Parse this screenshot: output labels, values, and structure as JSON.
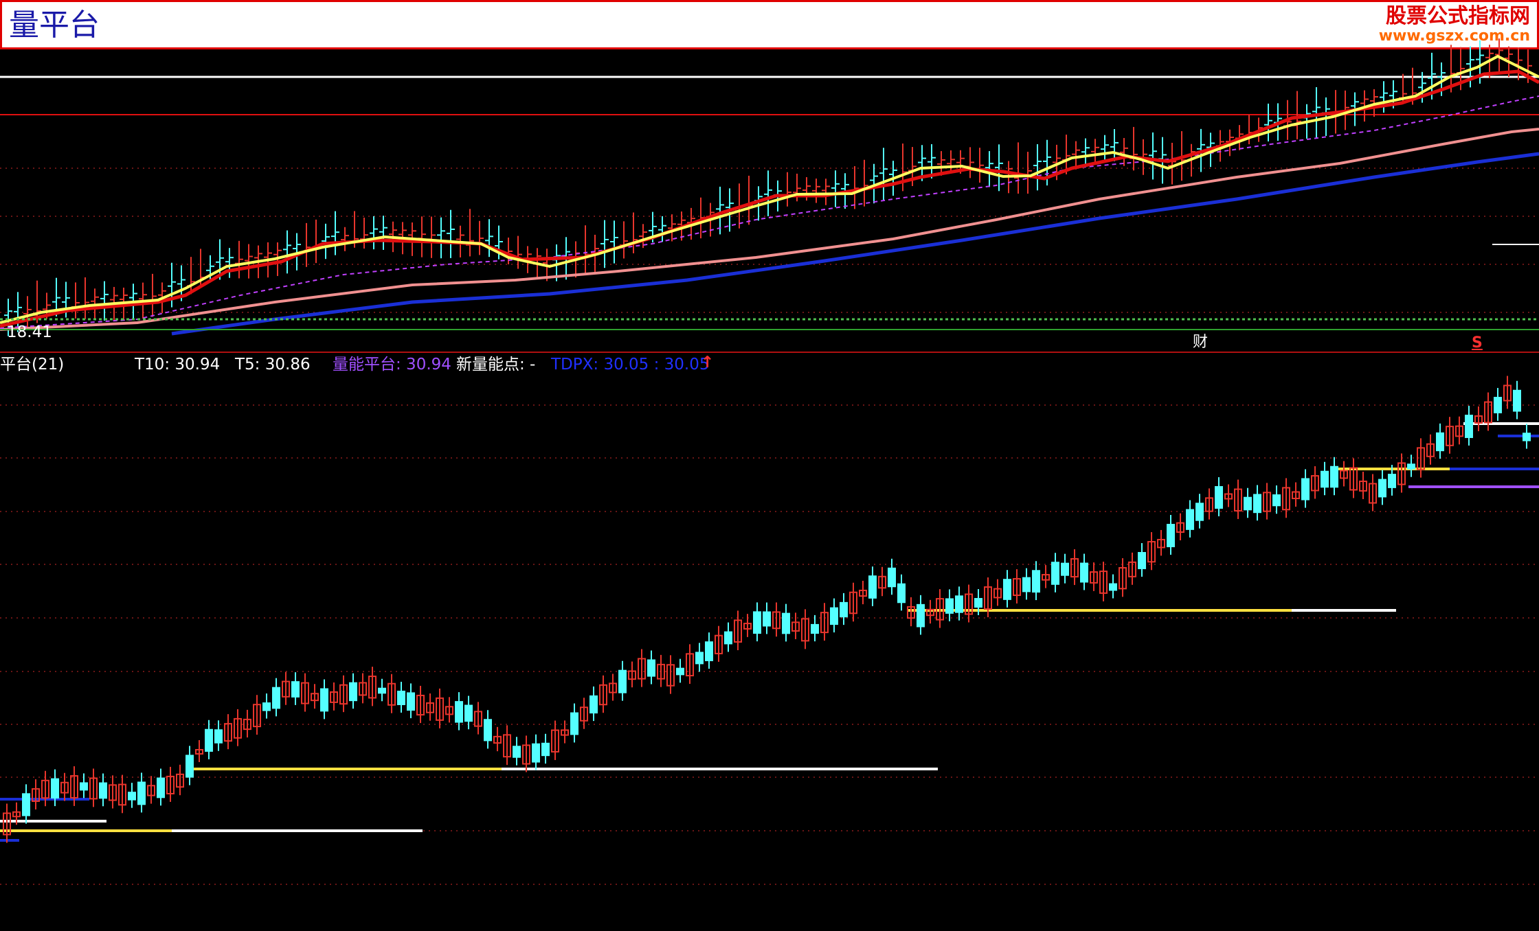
{
  "window": {
    "title": "量平台",
    "brand_cn": "股票公式指标网",
    "brand_url": "www.gszx.com.cn"
  },
  "main_panel": {
    "price_tag": "18.41",
    "finance_marker": "财",
    "signal_marker": "S"
  },
  "indicator_panel": {
    "name": "平台(21)",
    "t10": "T10: 30.94",
    "t5": "T5: 30.86",
    "volume_platform": "量能平台: 30.94",
    "new_volume_point": "新量能点: -",
    "tdpx": "TDPX: 30.05 : 30.05",
    "arrow": "↑"
  },
  "colors": {
    "background": "#000000",
    "up": "#e8352c",
    "down": "#54ffff",
    "ma_short": "#ffff60",
    "ma_mid": "#e01010",
    "ma_long": "#f0a0a0",
    "ma_xlong": "#1a2fd6",
    "dashed": "#c040ff",
    "platform": "#ffffff",
    "platform_alt": "#ffe040",
    "grid_dot": "#7a1a1a",
    "label_white": "#ffffff",
    "label_purple": "#a050ff",
    "label_blue": "#2030ff"
  }
}
